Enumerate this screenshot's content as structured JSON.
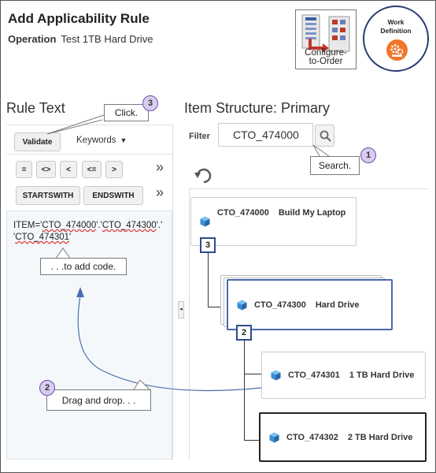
{
  "header": {
    "title": "Add Applicability Rule",
    "operation_label": "Operation",
    "operation_value": "Test 1TB Hard Drive",
    "cto_button_label_1": "Configure-",
    "cto_button_label_2": "to-Order",
    "wd_label_1": "Work",
    "wd_label_2": "Definition"
  },
  "rule_text": {
    "title": "Rule Text",
    "validate_label": "Validate",
    "keywords_label": "Keywords",
    "operators": [
      "=",
      "<>",
      "<",
      "<=",
      ">"
    ],
    "more_label": "»",
    "func_buttons": [
      "STARTSWITH",
      "ENDSWITH"
    ],
    "code_line_1a": "ITEM='",
    "code_line_1b": "CTO_474000",
    "code_line_1c": "'.'",
    "code_line_1d": "CTO_474300",
    "code_line_1e": "'.'",
    "code_line_2a": "'",
    "code_line_2b": "CTO_474301",
    "code_line_2c": "'"
  },
  "item_structure": {
    "title": "Item Structure: Primary",
    "filter_label": "Filter",
    "filter_value": "CTO_474000",
    "nodes": [
      {
        "code": "CTO_474000",
        "name": "Build My Laptop"
      },
      {
        "code": "CTO_474300",
        "name": "Hard Drive"
      },
      {
        "code": "CTO_474301",
        "name": "1 TB Hard Drive"
      },
      {
        "code": "CTO_474302",
        "name": "2 TB Hard Drive"
      }
    ],
    "counts": [
      "3",
      "2"
    ]
  },
  "callouts": {
    "click": "Click.",
    "search": "Search.",
    "add_code": ". . .to add code.",
    "drag": "Drag and drop. . .",
    "badge_1": "1",
    "badge_2": "2",
    "badge_3": "3"
  },
  "colors": {
    "accent_blue": "#2b4b8c",
    "badge_fill": "#d9ccee",
    "badge_stroke": "#6a4fb0",
    "wd_orange": "#f0762a",
    "cube_blue": "#3a8fd6"
  }
}
